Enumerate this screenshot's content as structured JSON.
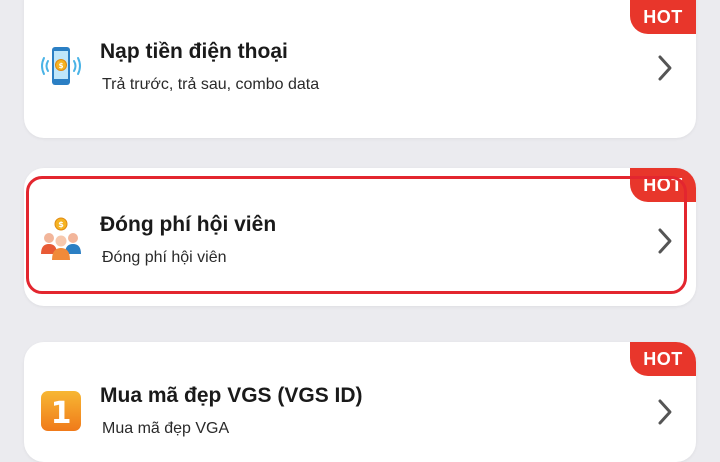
{
  "items": [
    {
      "title": "Nạp tiền điện thoại",
      "subtitle": "Trả trước, trả sau, combo data",
      "badge": "HOT",
      "icon": "phone-coin-icon"
    },
    {
      "title": "Đóng phí hội viên",
      "subtitle": "Đóng phí hội viên",
      "badge": "HOT",
      "icon": "members-coin-icon",
      "highlighted": true
    },
    {
      "title": "Mua mã đẹp VGS (VGS ID)",
      "subtitle": "Mua mã đẹp VGA",
      "badge": "HOT",
      "icon": "number-one-icon",
      "icon_text": "1"
    }
  ],
  "colors": {
    "background": "#ebebef",
    "card": "#ffffff",
    "hot_badge": "#e8362b",
    "highlight_border": "#e3262f"
  }
}
